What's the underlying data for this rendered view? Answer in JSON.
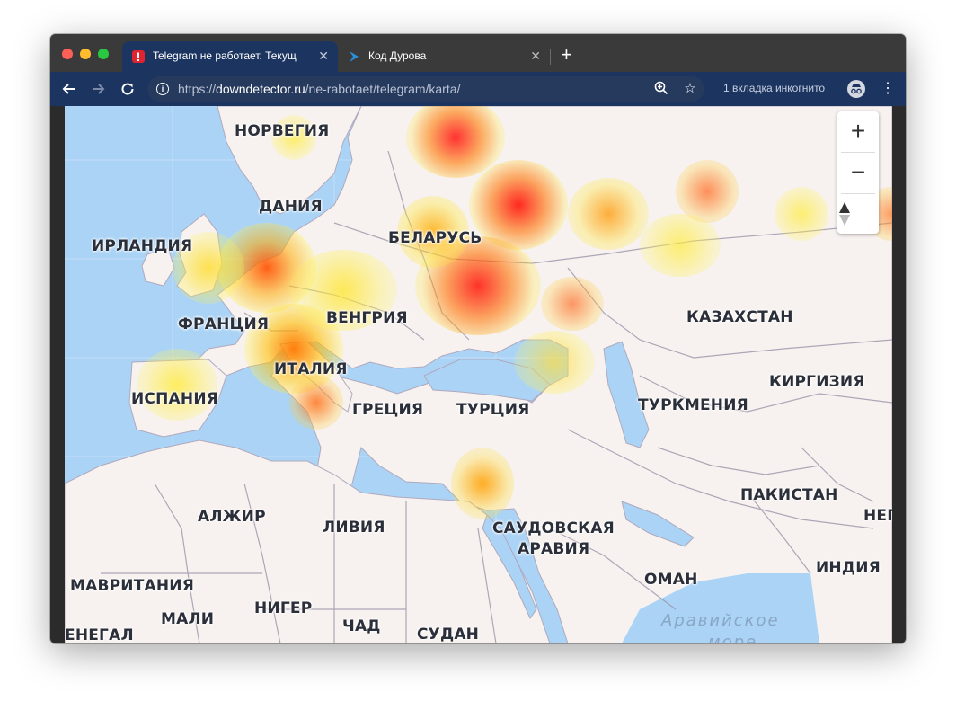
{
  "browser": {
    "tabs": [
      {
        "title": "Telegram не работает. Текущ",
        "active": true
      },
      {
        "title": "Код Дурова",
        "active": false
      }
    ],
    "close_glyph": "✕",
    "new_tab_glyph": "+",
    "url_scheme": "https://",
    "url_host": "downdetector.ru",
    "url_path": "/ne-rabotaet/telegram/karta/",
    "incognito_label": "1 вкладка инкогнито",
    "icons": [
      "back-arrow-icon",
      "forward-arrow-icon",
      "reload-icon",
      "info-icon",
      "zoom-icon",
      "star-icon",
      "incognito-icon",
      "more-menu-icon"
    ]
  },
  "map": {
    "zoom_in": "+",
    "zoom_out": "−",
    "compass": "▲",
    "countries": [
      "НОРВЕГИЯ",
      "ДАНИЯ",
      "ИРЛАНДИЯ",
      "БЕЛАРУСЬ",
      "ФРАНЦИЯ",
      "ВЕНГРИЯ",
      "КАЗАХСТАН",
      "ИТАЛИЯ",
      "ИСПАНИЯ",
      "ГРЕЦИЯ",
      "ТУРЦИЯ",
      "ТУРКМЕНИЯ",
      "КИРГИЗИЯ",
      "ПАКИСТАН",
      "АЛЖИР",
      "ЛИВИЯ",
      "САУДОВСКАЯ",
      "АРАВИЯ",
      "НЕП",
      "МАВРИТАНИЯ",
      "ИНДИЯ",
      "ОМАН",
      "МАЛИ",
      "НИГЕР",
      "ЧАД",
      "СУДАН",
      "ЕНЕГАЛ"
    ],
    "sea_labels": [
      "Аравийское",
      "море"
    ],
    "colors": {
      "water": "#aad3f5",
      "land": "#f7f2ef",
      "border": "#9a94a8",
      "hot": "#ff2a00",
      "warm": "#ff9900",
      "mild": "#ffee33"
    }
  }
}
